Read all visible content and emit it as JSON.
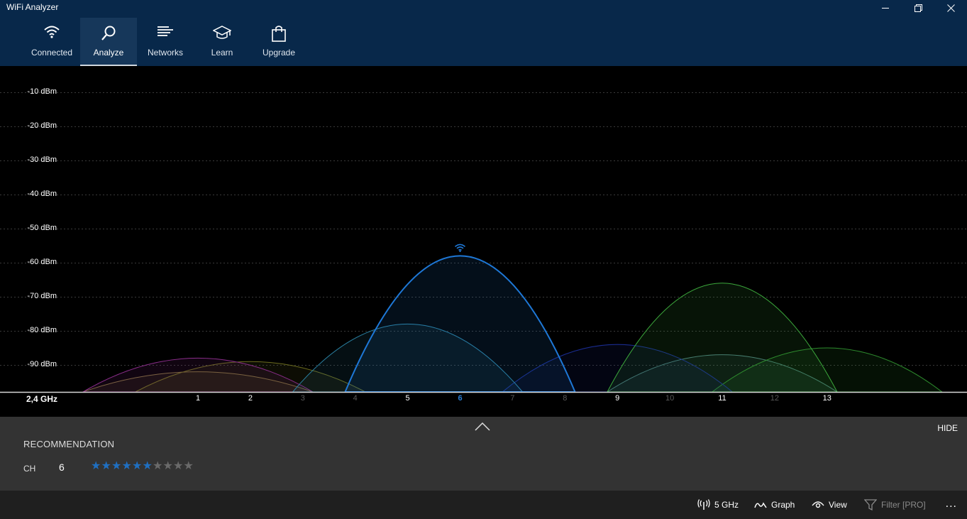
{
  "window": {
    "title": "WiFi Analyzer"
  },
  "nav": {
    "tabs": [
      {
        "label": "Connected",
        "icon": "wifi-icon",
        "active": false
      },
      {
        "label": "Analyze",
        "icon": "magnifier-icon",
        "active": true
      },
      {
        "label": "Networks",
        "icon": "list-icon",
        "active": false
      },
      {
        "label": "Learn",
        "icon": "graduation-cap-icon",
        "active": false
      },
      {
        "label": "Upgrade",
        "icon": "shopping-bag-icon",
        "active": false
      }
    ]
  },
  "chart_data": {
    "type": "area",
    "band": "2,4 GHz",
    "y_ticks": [
      "-10 dBm",
      "-20 dBm",
      "-30 dBm",
      "-40 dBm",
      "-50 dBm",
      "-60 dBm",
      "-70 dBm",
      "-80 dBm",
      "-90 dBm"
    ],
    "ylim": [
      -98,
      -2
    ],
    "channels": [
      {
        "label": "1",
        "dim": false
      },
      {
        "label": "2",
        "dim": false
      },
      {
        "label": "3",
        "dim": true
      },
      {
        "label": "4",
        "dim": true
      },
      {
        "label": "5",
        "dim": false
      },
      {
        "label": "6",
        "dim": false,
        "highlight": true
      },
      {
        "label": "7",
        "dim": true
      },
      {
        "label": "8",
        "dim": true
      },
      {
        "label": "9",
        "dim": false
      },
      {
        "label": "10",
        "dim": true
      },
      {
        "label": "11",
        "dim": false
      },
      {
        "label": "12",
        "dim": true
      },
      {
        "label": "13",
        "dim": false
      }
    ],
    "grid": true,
    "networks": [
      {
        "channel": 6,
        "signal_dbm": -58,
        "color": "#1e78d7",
        "connected": true
      },
      {
        "channel": 11,
        "signal_dbm": -66,
        "color": "#3ca83c",
        "connected": false
      },
      {
        "channel": 5,
        "signal_dbm": -78,
        "color": "#2a7fa0",
        "connected": false
      },
      {
        "channel": 9,
        "signal_dbm": -84,
        "color": "#1a2c90",
        "connected": false
      },
      {
        "channel": 13,
        "signal_dbm": -85,
        "color": "#2d8a2d",
        "connected": false
      },
      {
        "channel": 11,
        "signal_dbm": -87,
        "color": "#4a7a78",
        "connected": false
      },
      {
        "channel": 1,
        "signal_dbm": -88,
        "color": "#8a2d8a",
        "connected": false
      },
      {
        "channel": 2,
        "signal_dbm": -89,
        "color": "#6b6b1e",
        "connected": false
      },
      {
        "channel": 1,
        "signal_dbm": -92,
        "color": "#7a6a3a",
        "connected": false
      }
    ]
  },
  "recommendation": {
    "hide_label": "HIDE",
    "title": "RECOMMENDATION",
    "ch_label": "CH",
    "channel": "6",
    "rating": 6,
    "rating_max": 10
  },
  "commands": {
    "band": "5 GHz",
    "graph": "Graph",
    "view": "View",
    "filter": "Filter [PRO]",
    "more": "..."
  }
}
